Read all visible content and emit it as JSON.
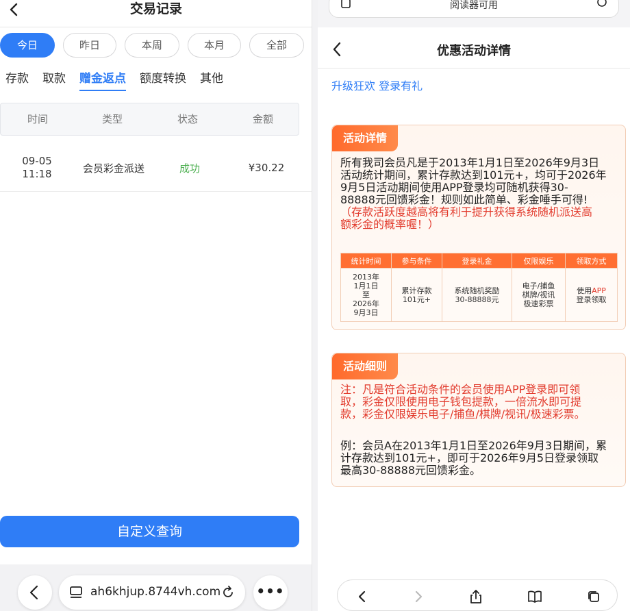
{
  "left": {
    "title": "交易记录",
    "date_filters": [
      "今日",
      "昨日",
      "本周",
      "本月",
      "全部"
    ],
    "type_tabs": [
      "存款",
      "取款",
      "赠金返点",
      "额度转换",
      "其他"
    ],
    "table": {
      "headers": [
        "时间",
        "类型",
        "状态",
        "金额"
      ],
      "rows": [
        {
          "date": "09-05",
          "time": "11:18",
          "type": "会员彩金派送",
          "status": "成功",
          "amount": "¥30.22"
        }
      ]
    },
    "query_button": "自定义查询",
    "bottom": {
      "url": "ah6khjup.8744vh.com",
      "more": "•••"
    }
  },
  "right": {
    "address_bar": "阅读器可用",
    "title": "优惠活动详情",
    "promo_title": "升级狂欢 登录有礼",
    "detail_card": {
      "tag": "活动详情",
      "lines": [
        "所有我司会员凡是于2013年1月1日至2026年9月3日",
        "活动统计期间，累计存款达到101元+，均可于2026年",
        "9月5日活动期间使用APP登录均可随机获得30-",
        "88888元回馈彩金！规则如此简单、彩金唾手可得!"
      ],
      "red_lines": [
        "（存款活跃度越高将有利于提升获得系统随机派送高",
        "额彩金的概率喔！）"
      ],
      "table_headers": [
        "统计时间",
        "参与条件",
        "登录礼金",
        "仅限娱乐",
        "领取方式"
      ],
      "table_cells": {
        "time": [
          "2013年",
          "1月1日",
          "至",
          "2026年",
          "9月3日"
        ],
        "condition": [
          "累计存款",
          "101元+"
        ],
        "bonus": [
          "系统随机奖励",
          "30-88888元"
        ],
        "games": [
          "电子/捕鱼",
          "棋牌/视讯",
          "极速彩票"
        ],
        "claim_prefix": "使用",
        "claim_app": "APP",
        "claim_suffix": "登录领取"
      }
    },
    "rules_card": {
      "tag": "活动细则",
      "note_lines": [
        "注：凡是符合活动条件的会员使用APP登录即可领",
        "取，彩金仅限使用电子钱包提款，一倍流水即可提",
        "款，彩金仅限娱乐电子/捕鱼/棋牌/视讯/极速彩票。"
      ],
      "example_lines": [
        "例：会员A在2013年1月1日至2026年9月3日期间，累",
        "计存款达到101元+，即可于2026年9月5日登录领取",
        "最高30-88888元回馈彩金。"
      ]
    }
  },
  "colors": {
    "accent_blue": "#2f7df6",
    "accent_orange": "#ff6f32",
    "success_green": "#4caf50",
    "warn_red": "#e23a2c"
  }
}
